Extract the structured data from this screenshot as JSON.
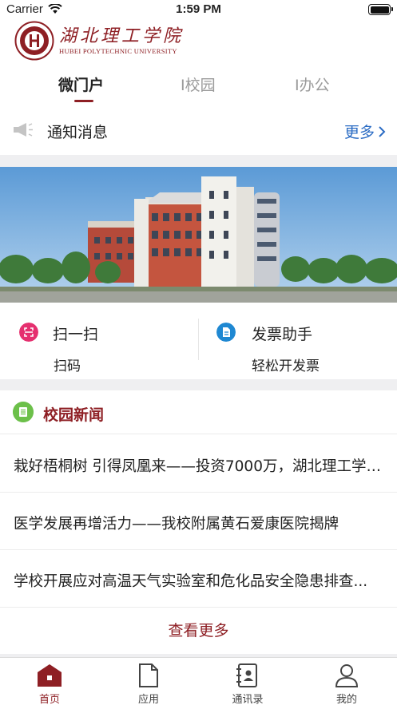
{
  "status_bar": {
    "carrier": "Carrier",
    "time": "1:59 PM"
  },
  "header": {
    "logo_cn": "湖北理工学院",
    "logo_en": "HUBEI POLYTECHNIC UNIVERSITY"
  },
  "tabs": [
    {
      "label": "微门户",
      "active": true
    },
    {
      "label": "I校园",
      "active": false
    },
    {
      "label": "I办公",
      "active": false
    }
  ],
  "notice": {
    "label": "通知消息",
    "more": "更多"
  },
  "quick_actions": [
    {
      "title": "扫一扫",
      "subtitle": "扫码",
      "icon": "scan-icon",
      "color": "#e5306f"
    },
    {
      "title": "发票助手",
      "subtitle": "轻松开发票",
      "icon": "invoice-icon",
      "color": "#1f88d2"
    }
  ],
  "news": {
    "title": "校园新闻",
    "items": [
      "栽好梧桐树 引得凤凰来——投资7000万，湖北理工学院...",
      "医学发展再增活力——我校附属黄石爱康医院揭牌",
      "学校开展应对高温天气实验室和危化品安全隐患排查..."
    ],
    "more": "查看更多"
  },
  "tabbar": [
    {
      "label": "首页",
      "icon": "home-icon",
      "active": true
    },
    {
      "label": "应用",
      "icon": "document-icon",
      "active": false
    },
    {
      "label": "通讯录",
      "icon": "contacts-icon",
      "active": false
    },
    {
      "label": "我的",
      "icon": "user-icon",
      "active": false
    }
  ],
  "colors": {
    "brand": "#8e1f24",
    "link": "#2b6cc4",
    "news_icon": "#6cc04a"
  }
}
